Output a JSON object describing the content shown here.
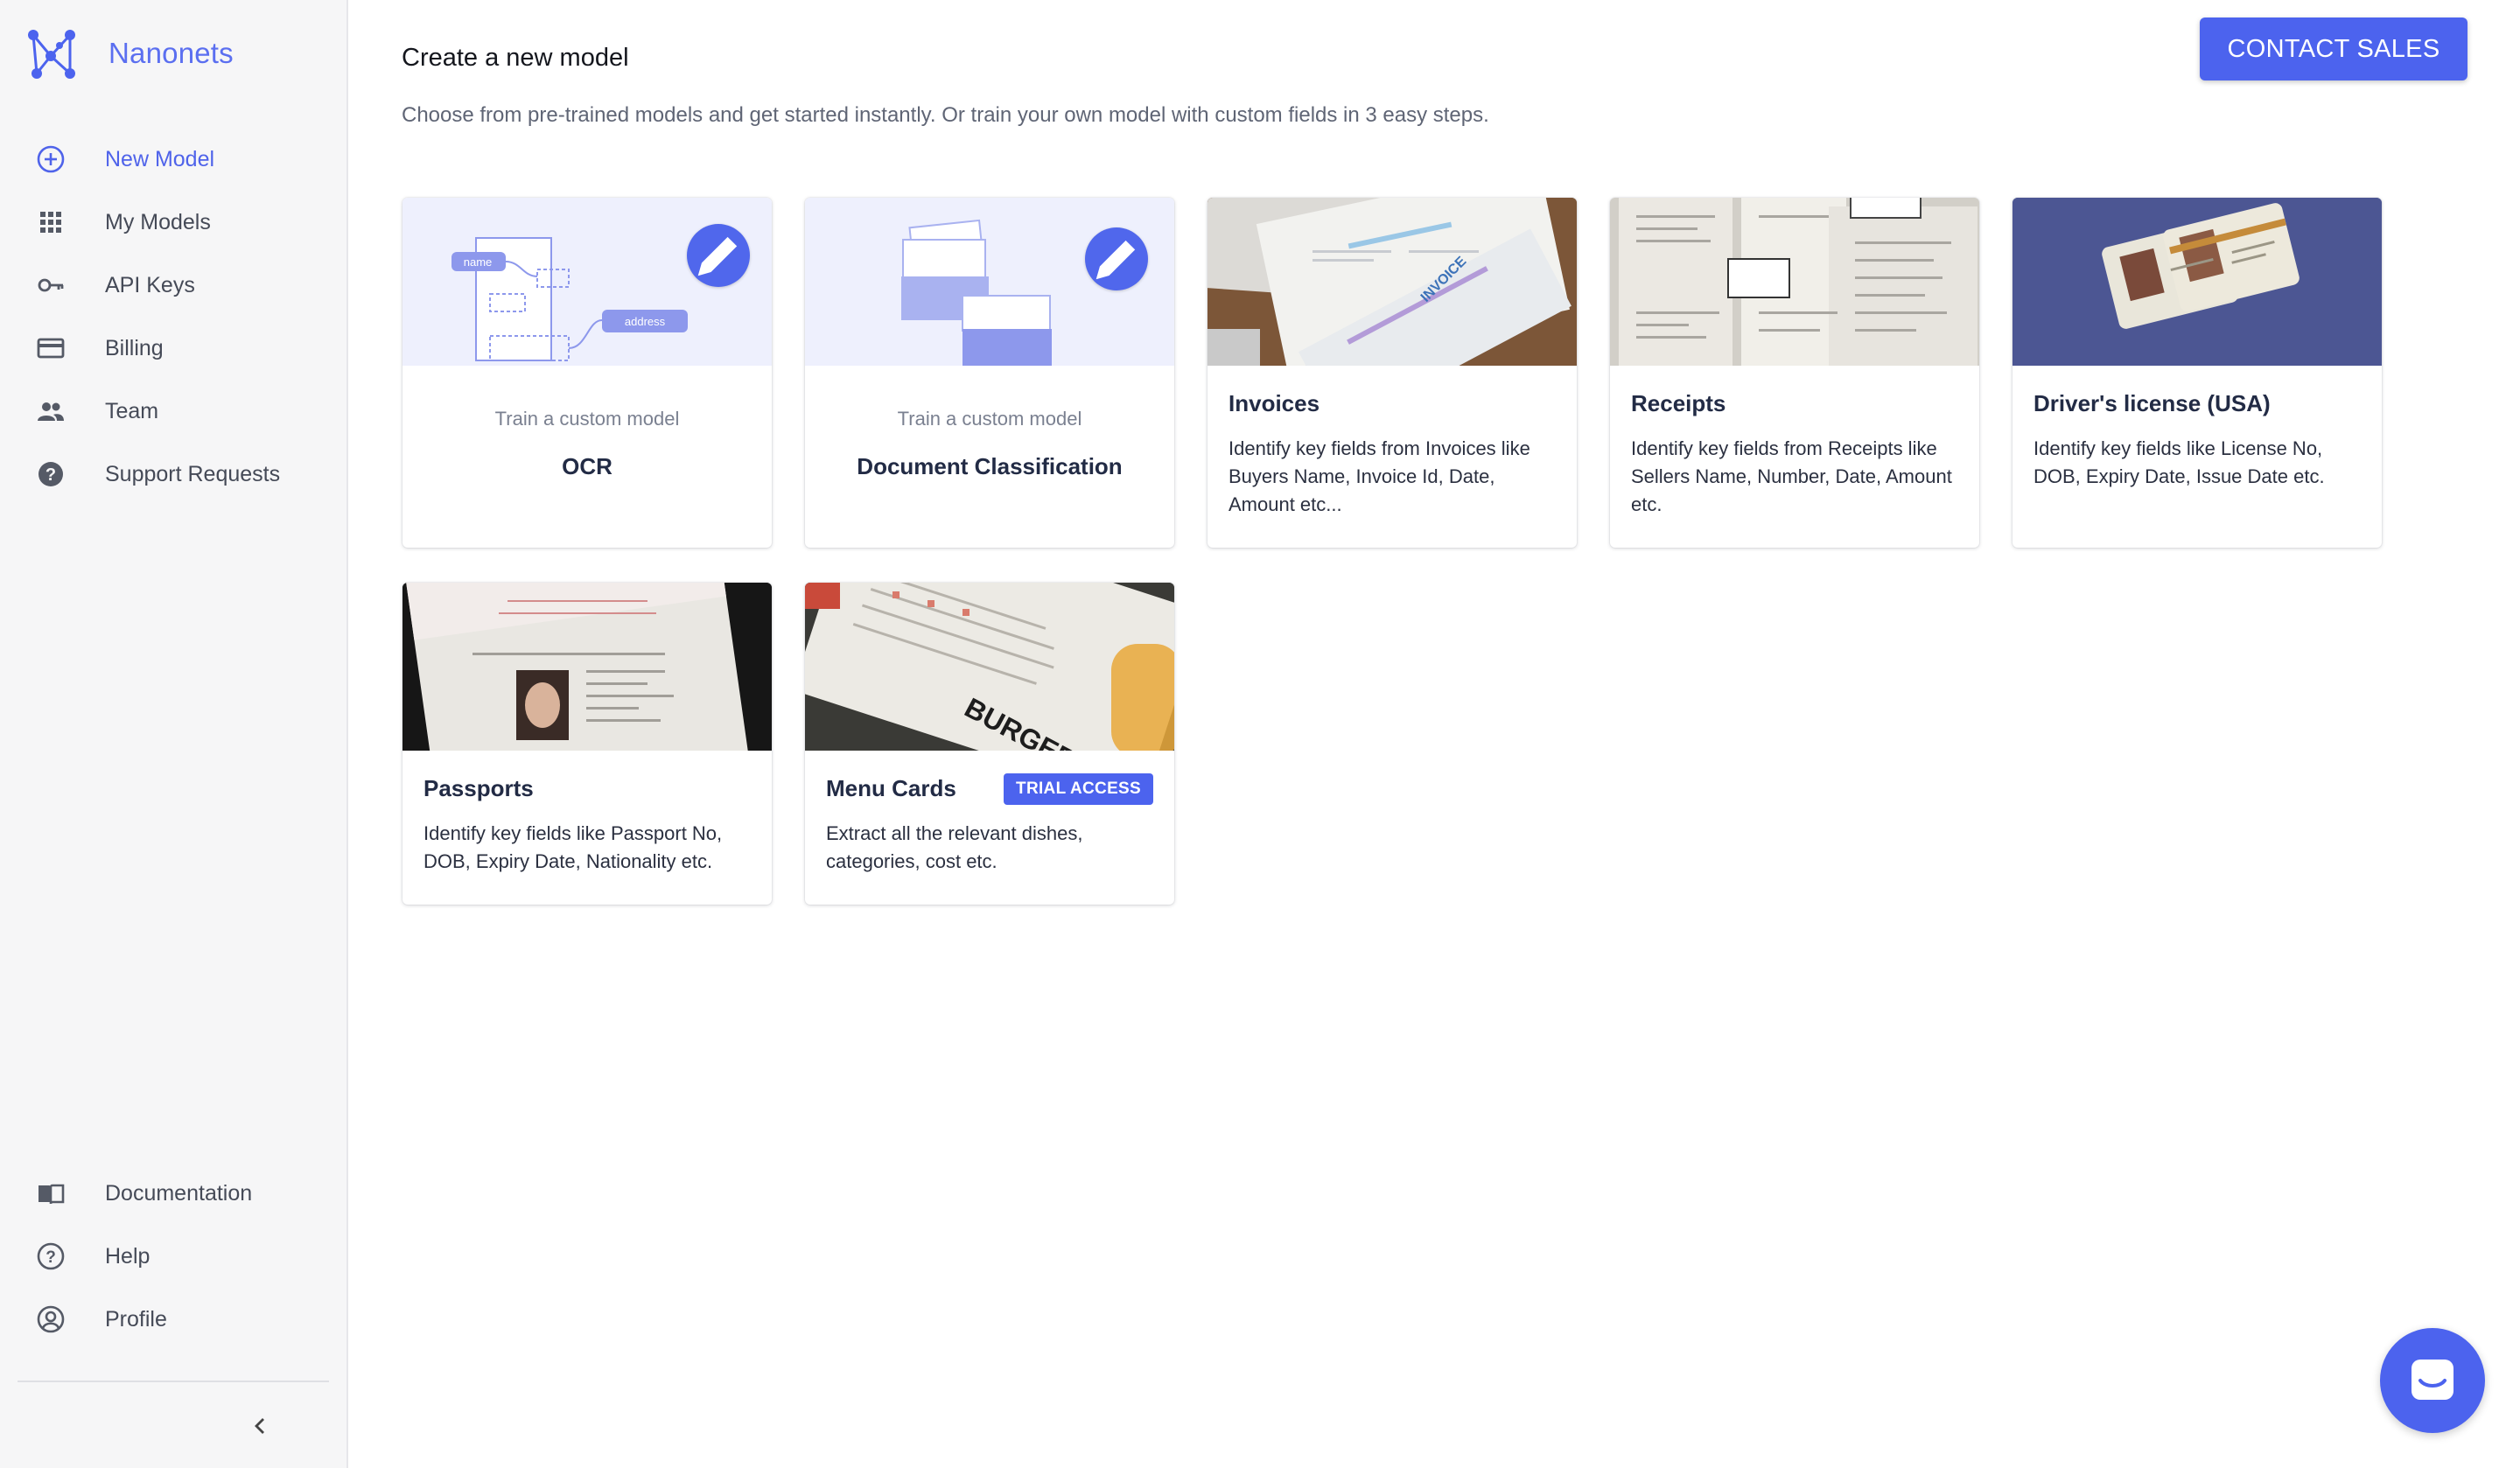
{
  "brand": {
    "name": "Nanonets",
    "accent": "#4c63ee"
  },
  "sidebar": {
    "items": [
      {
        "label": "New Model",
        "icon": "plus-circle-icon",
        "active": true
      },
      {
        "label": "My Models",
        "icon": "grid-icon"
      },
      {
        "label": "API Keys",
        "icon": "key-icon"
      },
      {
        "label": "Billing",
        "icon": "credit-card-icon"
      },
      {
        "label": "Team",
        "icon": "people-icon"
      },
      {
        "label": "Support Requests",
        "icon": "help-circle-filled-icon"
      }
    ],
    "bottom_items": [
      {
        "label": "Documentation",
        "icon": "book-icon"
      },
      {
        "label": "Help",
        "icon": "help-circle-icon"
      },
      {
        "label": "Profile",
        "icon": "user-circle-icon"
      }
    ],
    "collapse_icon": "chevron-left-icon"
  },
  "header": {
    "title": "Create a new model",
    "subtitle": "Choose from pre-trained models and get started instantly. Or train your own model with custom fields in 3 easy steps.",
    "contact_label": "CONTACT SALES"
  },
  "cards": [
    {
      "kind": "custom",
      "small": "Train a custom model",
      "title": "OCR",
      "thumb_labels": [
        "name",
        "address"
      ]
    },
    {
      "kind": "custom",
      "small": "Train a custom model",
      "title": "Document Classification"
    },
    {
      "kind": "pretrained",
      "title": "Invoices",
      "desc": "Identify key fields from Invoices like Buyers Name, Invoice Id, Date, Amount etc...",
      "thumb_text": "INVOICE"
    },
    {
      "kind": "pretrained",
      "title": "Receipts",
      "desc": "Identify key fields from Receipts like Sellers Name, Number, Date, Amount etc."
    },
    {
      "kind": "pretrained",
      "title": "Driver's license (USA)",
      "desc": "Identify key fields like License No, DOB, Expiry Date, Issue Date etc."
    },
    {
      "kind": "pretrained",
      "title": "Passports",
      "desc": "Identify key fields like Passport No, DOB, Expiry Date, Nationality etc."
    },
    {
      "kind": "pretrained",
      "title": "Menu Cards",
      "badge": "TRIAL ACCESS",
      "desc": "Extract all the relevant dishes, categories, cost etc.",
      "thumb_text": "BURGERS"
    }
  ],
  "chat_icon": "chat-bubble-icon"
}
